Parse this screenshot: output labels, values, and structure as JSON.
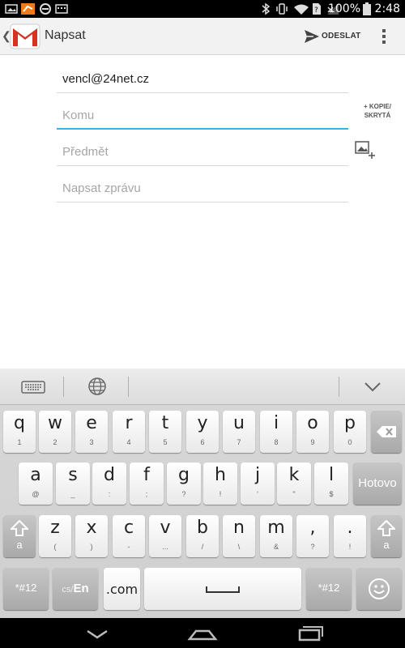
{
  "status_bar": {
    "battery_percent": "100%",
    "time": "2:48"
  },
  "action_bar": {
    "back_glyph": "❮",
    "title": "Napsat",
    "send_label": "ODESLAT",
    "icons": [
      "gmail-logo",
      "send-icon",
      "overflow-menu-icon"
    ]
  },
  "compose": {
    "from": "vencl@24net.cz",
    "to_placeholder": "Komu",
    "cc_bcc_line1": "+ KOPIE/",
    "cc_bcc_line2": "SKRYTÁ",
    "subject_placeholder": "Předmět",
    "body_placeholder": "Napsat zprávu"
  },
  "keyboard": {
    "row1": [
      {
        "key": "q",
        "sub": "1"
      },
      {
        "key": "w",
        "sub": "2"
      },
      {
        "key": "e",
        "sub": "3"
      },
      {
        "key": "r",
        "sub": "4"
      },
      {
        "key": "t",
        "sub": "5"
      },
      {
        "key": "y",
        "sub": "6"
      },
      {
        "key": "u",
        "sub": "7"
      },
      {
        "key": "i",
        "sub": "8"
      },
      {
        "key": "o",
        "sub": "9"
      },
      {
        "key": "p",
        "sub": "0"
      }
    ],
    "row2": [
      {
        "key": "a",
        "sub": "@"
      },
      {
        "key": "s",
        "sub": "_"
      },
      {
        "key": "d",
        "sub": ":"
      },
      {
        "key": "f",
        "sub": ";"
      },
      {
        "key": "g",
        "sub": "?"
      },
      {
        "key": "h",
        "sub": "!"
      },
      {
        "key": "j",
        "sub": "'"
      },
      {
        "key": "k",
        "sub": "\""
      },
      {
        "key": "l",
        "sub": "$"
      }
    ],
    "row3": [
      {
        "key": "z",
        "sub": "("
      },
      {
        "key": "x",
        "sub": ")"
      },
      {
        "key": "c",
        "sub": "-"
      },
      {
        "key": "v",
        "sub": "..."
      },
      {
        "key": "b",
        "sub": "/"
      },
      {
        "key": "n",
        "sub": "\\"
      },
      {
        "key": "m",
        "sub": "&"
      },
      {
        "key": ",",
        "sub": "?"
      },
      {
        "key": ".",
        "sub": "!"
      }
    ],
    "done_label": "Hotovo",
    "symbols_label": "*#12",
    "lang_prefix": "cs/",
    "lang_label": "En",
    "dotcom_label": ".com",
    "shift_sub": "a",
    "icons": [
      "keyboard-icon",
      "globe-icon",
      "chevron-down-icon",
      "backspace-icon",
      "shift-icon",
      "space-icon",
      "emoji-icon"
    ]
  },
  "nav_bar": {
    "icons": [
      "back-icon",
      "home-icon",
      "recent-apps-icon"
    ]
  }
}
